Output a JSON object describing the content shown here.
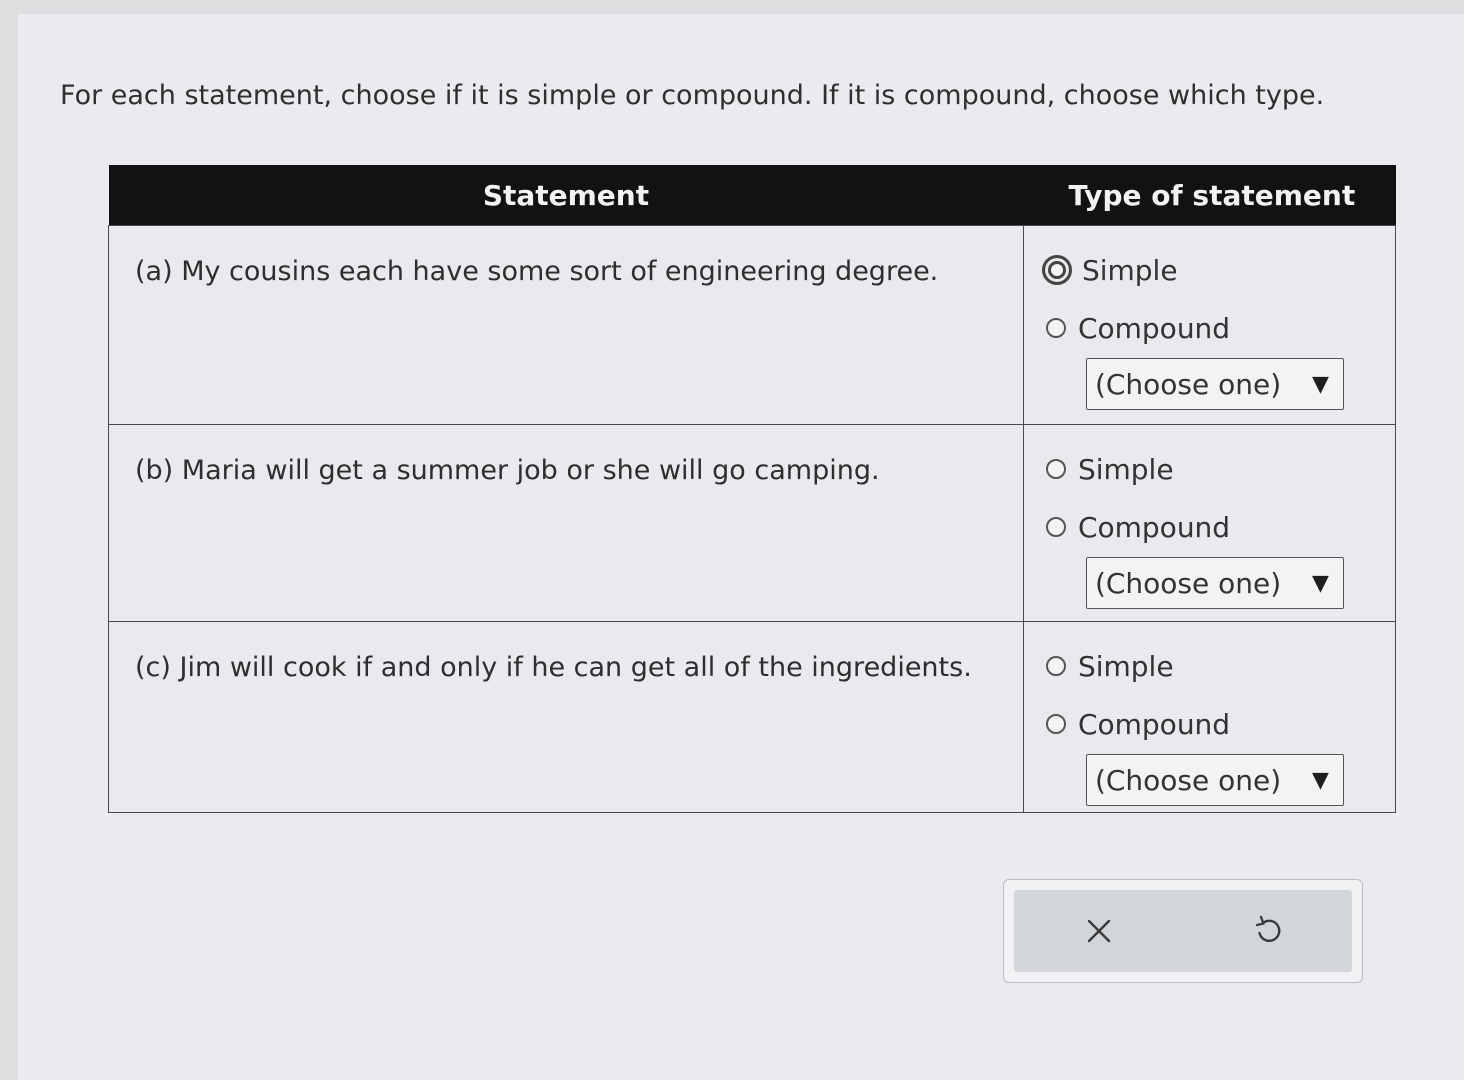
{
  "instruction": "For each statement, choose if it is simple or compound. If it is compound, choose which type.",
  "table": {
    "headers": {
      "statement": "Statement",
      "type": "Type of statement"
    },
    "rows": [
      {
        "statement": "(a) My cousins each have some sort of engineering degree.",
        "option_simple": "Simple",
        "option_compound": "Compound",
        "select_value": "(Choose one)"
      },
      {
        "statement": "(b) Maria will get a summer job or she will go camping.",
        "option_simple": "Simple",
        "option_compound": "Compound",
        "select_value": "(Choose one)"
      },
      {
        "statement": "(c) Jim will cook if and only if he can get all of the ingredients.",
        "option_simple": "Simple",
        "option_compound": "Compound",
        "select_value": "(Choose one)"
      }
    ]
  },
  "caret_glyph": "▼",
  "icons": {
    "clear": "close-icon",
    "undo": "undo-icon"
  }
}
